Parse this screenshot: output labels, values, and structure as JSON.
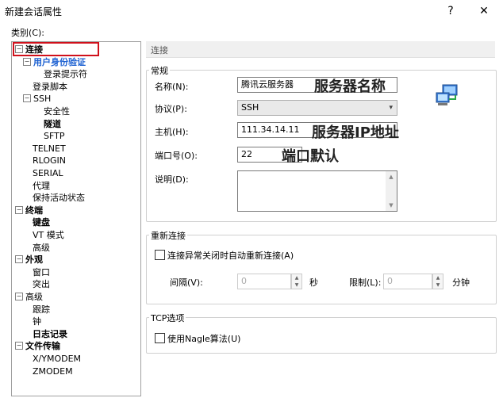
{
  "window": {
    "title": "新建会话属性",
    "help_glyph": "?",
    "close_glyph": "✕"
  },
  "category_label": "类别(C):",
  "tree": [
    {
      "label": "连接",
      "bold": true,
      "exp": "⊟"
    },
    {
      "label": "用户身份验证",
      "selected": true,
      "exp": "⊟"
    },
    {
      "label": "登录提示符"
    },
    {
      "label": "登录脚本"
    },
    {
      "label": "SSH",
      "exp": "⊟"
    },
    {
      "label": "安全性"
    },
    {
      "label": "隧道",
      "bold": true
    },
    {
      "label": "SFTP"
    },
    {
      "label": "TELNET"
    },
    {
      "label": "RLOGIN"
    },
    {
      "label": "SERIAL"
    },
    {
      "label": "代理"
    },
    {
      "label": "保持活动状态"
    },
    {
      "label": "终端",
      "bold": true,
      "exp": "⊟"
    },
    {
      "label": "键盘",
      "bold": true
    },
    {
      "label": "VT 模式"
    },
    {
      "label": "高级"
    },
    {
      "label": "外观",
      "bold": true,
      "exp": "⊟"
    },
    {
      "label": "窗口"
    },
    {
      "label": "突出"
    },
    {
      "label": "高级",
      "exp": "⊟"
    },
    {
      "label": "跟踪"
    },
    {
      "label": "钟"
    },
    {
      "label": "日志记录",
      "bold": true
    },
    {
      "label": "文件传输",
      "bold": true,
      "exp": "⊟"
    },
    {
      "label": "X/YMODEM"
    },
    {
      "label": "ZMODEM"
    }
  ],
  "panel": {
    "header": "连接",
    "general": {
      "title": "常规",
      "name_label": "名称(N):",
      "name_value": "腾讯云服务器",
      "protocol_label": "协议(P):",
      "protocol_value": "SSH",
      "host_label": "主机(H):",
      "host_value": "111.34.14.11",
      "port_label": "端口号(O):",
      "port_value": "22",
      "desc_label": "说明(D):",
      "desc_value": ""
    },
    "reconnect": {
      "title": "重新连接",
      "checkbox_label": "连接异常关闭时自动重新连接(A)",
      "interval_label": "间隔(V):",
      "interval_value": "0",
      "interval_unit": "秒",
      "limit_label": "限制(L):",
      "limit_value": "0",
      "limit_unit": "分钟"
    },
    "tcp": {
      "title": "TCP选项",
      "nagle_label": "使用Nagle算法(U)"
    }
  },
  "annotations": {
    "server_name": "服务器名称",
    "server_ip": "服务器IP地址",
    "port_default": "端口默认"
  }
}
